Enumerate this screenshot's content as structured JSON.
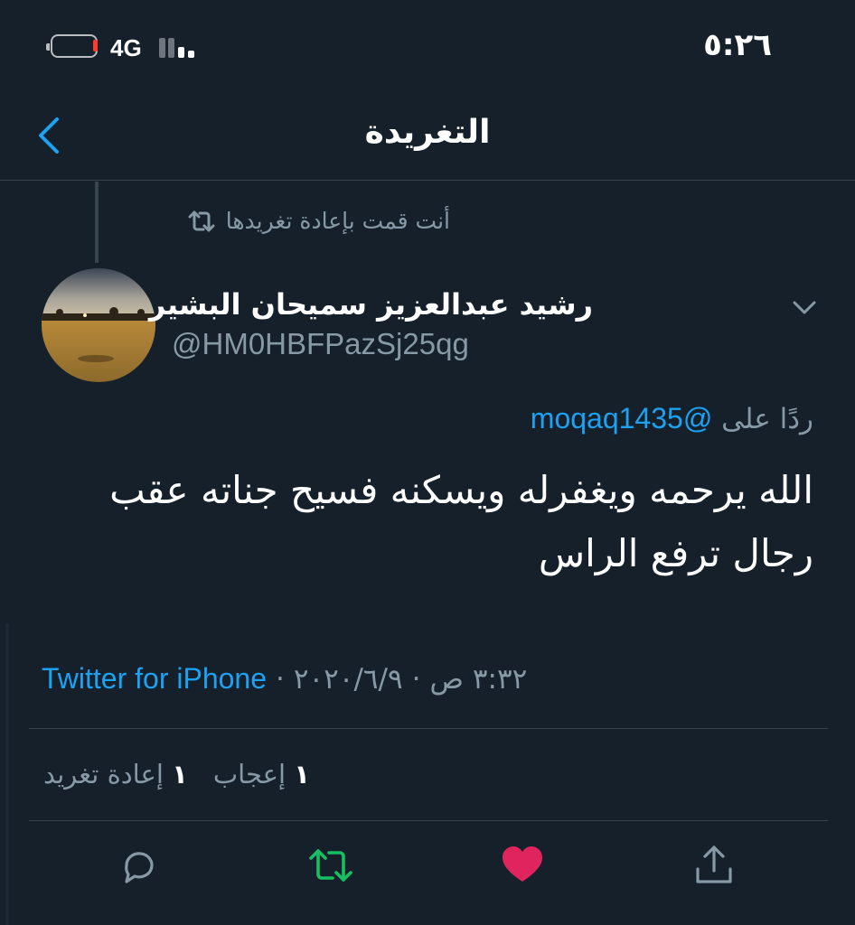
{
  "status_bar": {
    "network": "4G",
    "time": "٥:٢٦"
  },
  "header": {
    "title": "التغريدة"
  },
  "tweet": {
    "retweet_context": "أنت قمت بإعادة تغريدها",
    "author_name": "رشيد عبدالعزيز سميحان البشير",
    "author_handle": "@HM0HBFPazSj25qg",
    "reply_prefix": "ردًا على",
    "reply_mention": "@moqaq1435",
    "text": "الله يرحمه ويغفرله ويسكنه فسيح جناته عقب رجال ترفع الراس",
    "time": "٣:٣٢ ص",
    "date": "٢٠٢٠/٦/٩",
    "separator": "·",
    "source": "Twitter for iPhone"
  },
  "stats": {
    "retweets_count": "١",
    "retweets_label": "إعادة تغريد",
    "likes_count": "١",
    "likes_label": "إعجاب"
  },
  "colors": {
    "background": "#15202b",
    "accent": "#1da1f2",
    "retweet_active": "#17bf63",
    "like_active": "#e0245e",
    "secondary_text": "#8899a6"
  },
  "icons": {
    "back": "chevron-left-icon",
    "retweet_context": "retweet-icon",
    "caret": "chevron-down-icon",
    "reply": "reply-icon",
    "retweet": "retweet-icon",
    "like": "heart-icon",
    "share": "share-icon"
  }
}
